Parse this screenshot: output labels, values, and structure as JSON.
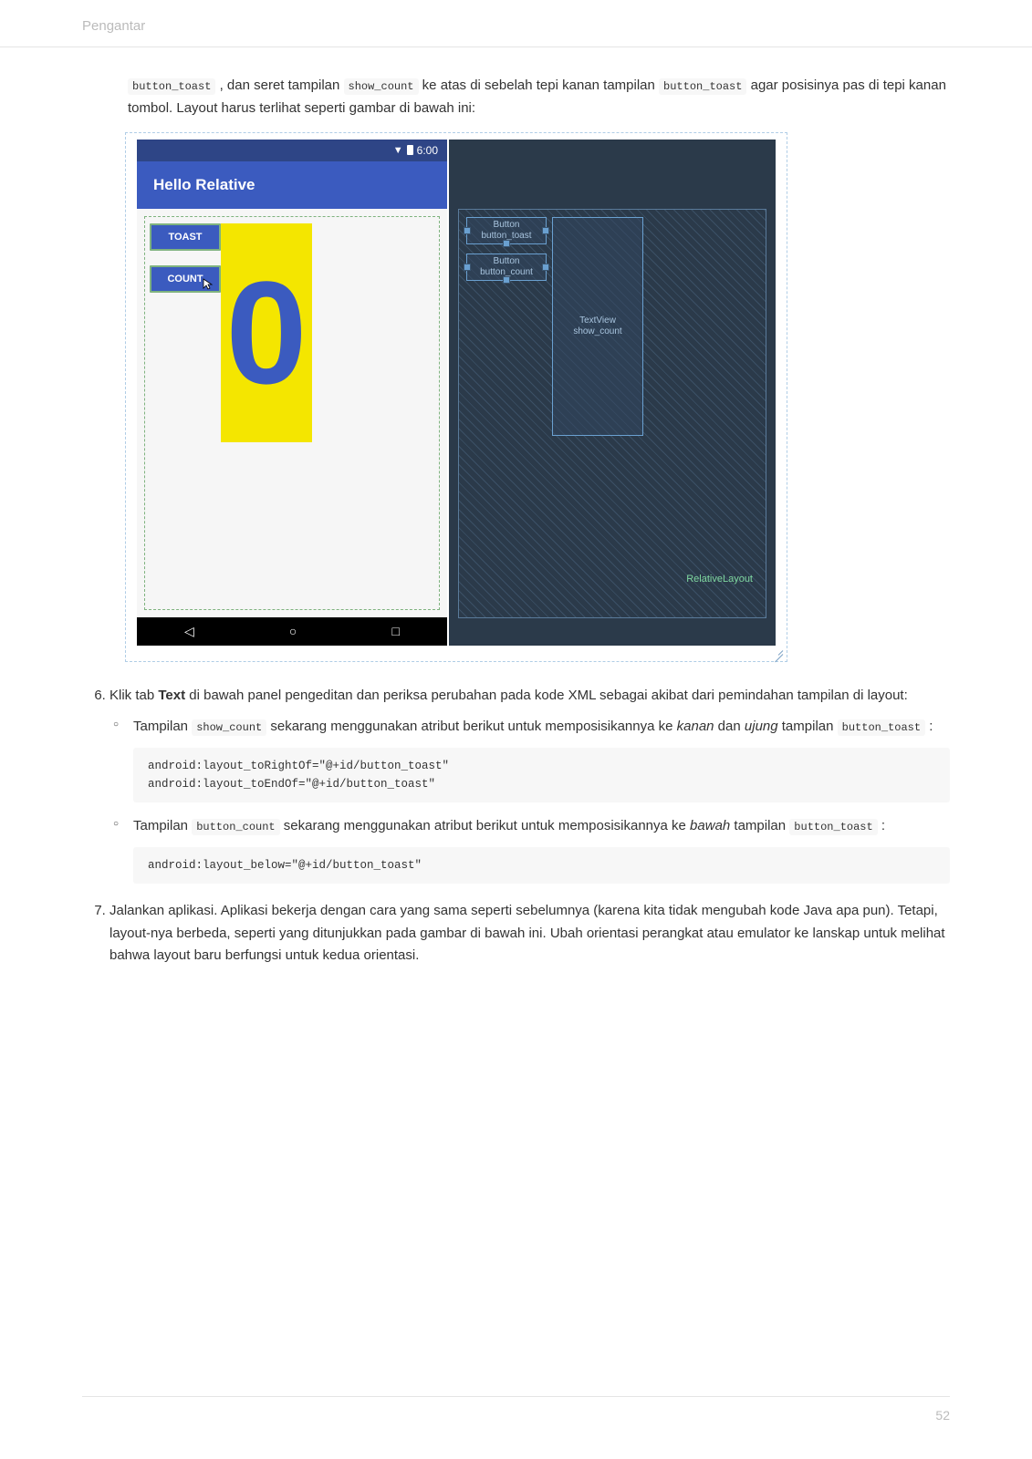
{
  "header": {
    "title": "Pengantar"
  },
  "intro": {
    "code1": "button_toast",
    "txt1": " , dan seret tampilan ",
    "code2": "show_count",
    "txt2": " ke atas di sebelah tepi kanan tampilan ",
    "code3": "button_toast",
    "txt3": " agar posisinya pas di tepi kanan tombol. Layout harus terlihat seperti gambar di bawah ini:"
  },
  "figure": {
    "status_time": "6:00",
    "app_title": "Hello Relative",
    "btn_toast": "TOAST",
    "btn_count": "COUNT",
    "zero": "0",
    "bp_toast": "Button\nbutton_toast",
    "bp_count": "Button\nbutton_count",
    "bp_tv": "TextView\nshow_count",
    "bp_rel": "RelativeLayout",
    "nav_back": "◁",
    "nav_home": "○",
    "nav_recent": "□"
  },
  "step6": {
    "num": "6",
    "lead_a": "Klik tab ",
    "lead_bold": "Text",
    "lead_b": " di bawah panel pengeditan dan periksa perubahan pada kode XML sebagai akibat dari pemindahan tampilan di layout:",
    "sub1_a": "Tampilan ",
    "sub1_code1": "show_count",
    "sub1_b": " sekarang menggunakan atribut berikut untuk memposisikannya ke ",
    "sub1_em1": "kanan",
    "sub1_c": " dan ",
    "sub1_em2": "ujung",
    "sub1_d": " tampilan ",
    "sub1_code2": "button_toast",
    "sub1_e": " :",
    "code1": "android:layout_toRightOf=\"@+id/button_toast\"\nandroid:layout_toEndOf=\"@+id/button_toast\"",
    "sub2_a": "Tampilan ",
    "sub2_code1": "button_count",
    "sub2_b": " sekarang menggunakan atribut berikut untuk memposisikannya ke ",
    "sub2_em1": "bawah",
    "sub2_c": " tampilan ",
    "sub2_code2": "button_toast",
    "sub2_d": " :",
    "code2": "android:layout_below=\"@+id/button_toast\""
  },
  "step7": {
    "num": "7",
    "text": "Jalankan aplikasi. Aplikasi bekerja dengan cara yang sama seperti sebelumnya (karena kita tidak mengubah kode Java apa pun). Tetapi, layout-nya berbeda, seperti yang ditunjukkan pada gambar di bawah ini. Ubah orientasi perangkat atau emulator ke lanskap untuk melihat bahwa layout baru berfungsi untuk kedua orientasi."
  },
  "footer": {
    "page": "52"
  }
}
